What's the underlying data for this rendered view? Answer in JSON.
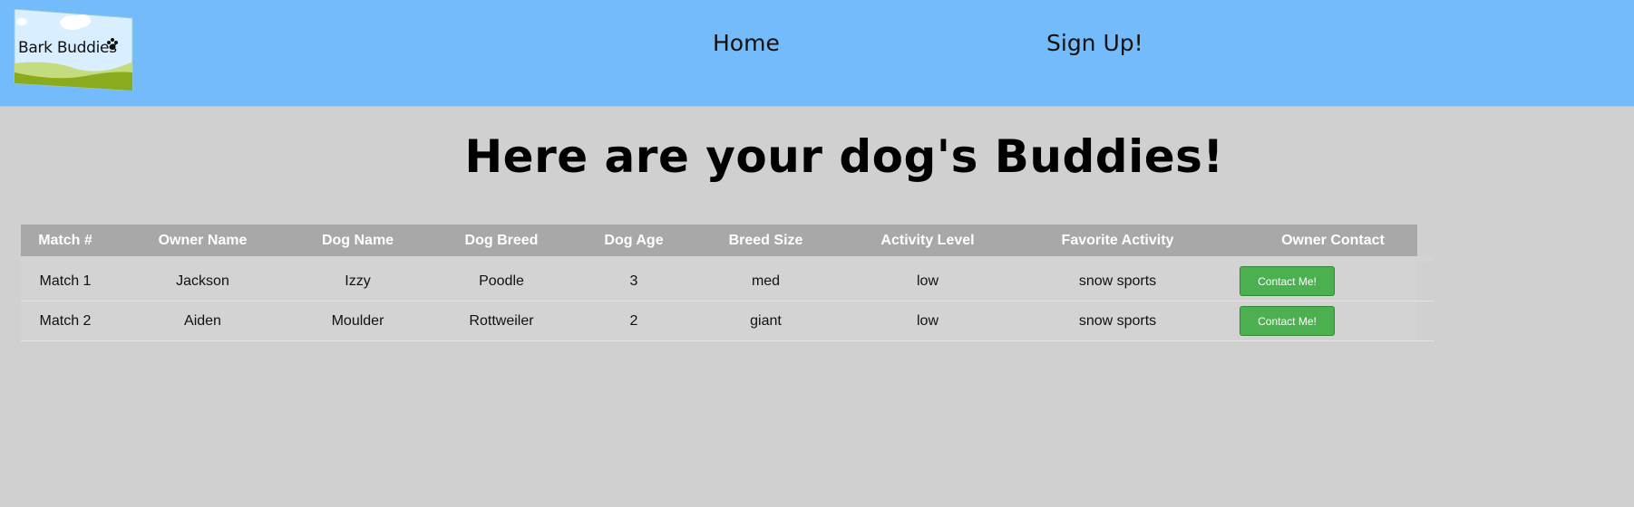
{
  "nav": {
    "logo_text": "Bark Buddies",
    "links": [
      {
        "label": "Home"
      },
      {
        "label": "Sign Up!"
      }
    ]
  },
  "page": {
    "title": "Here are your dog's Buddies!"
  },
  "table": {
    "headers": [
      "Match #",
      "Owner Name",
      "Dog Name",
      "Dog Breed",
      "Dog Age",
      "Breed Size",
      "Activity Level",
      "Favorite Activity",
      "Owner Contact"
    ],
    "rows": [
      {
        "match": "Match 1",
        "owner": "Jackson",
        "dog": "Izzy",
        "breed": "Poodle",
        "age": "3",
        "size": "med",
        "activity_level": "low",
        "favorite": "snow sports",
        "contact_label": "Contact Me!"
      },
      {
        "match": "Match 2",
        "owner": "Aiden",
        "dog": "Moulder",
        "breed": "Rottweiler",
        "age": "2",
        "size": "giant",
        "activity_level": "low",
        "favorite": "snow sports",
        "contact_label": "Contact Me!"
      }
    ]
  },
  "colors": {
    "navbar": "#73bbfa",
    "background": "#d0d0d0",
    "header_row": "#a8a8a8",
    "button": "#4caf50"
  }
}
